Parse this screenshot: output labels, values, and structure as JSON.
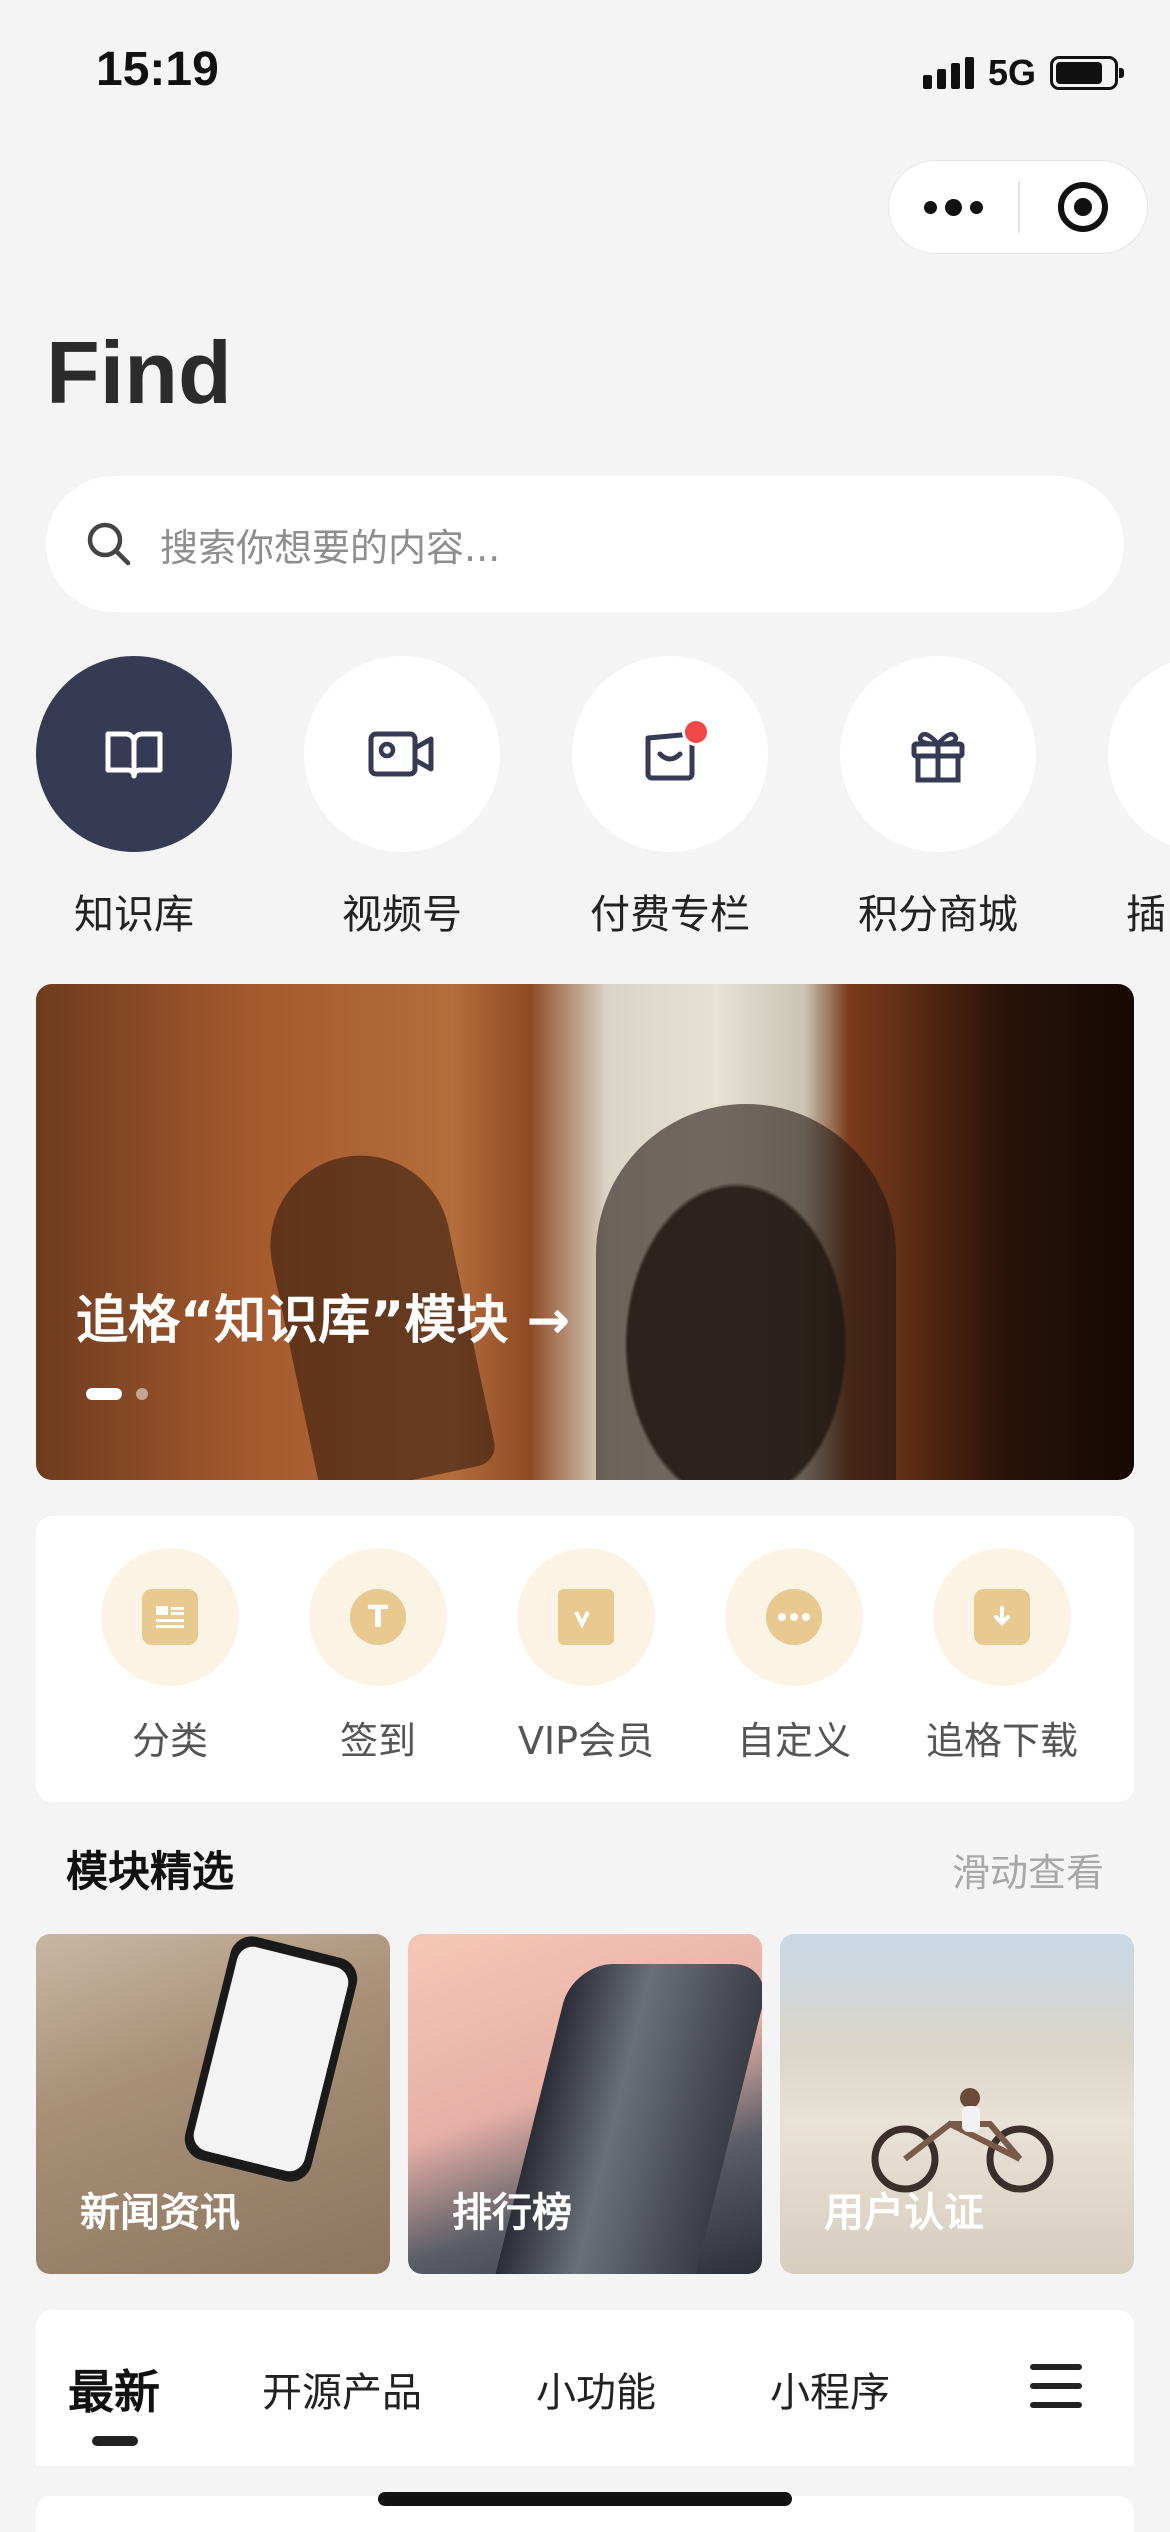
{
  "status": {
    "time": "15:19",
    "network": "5G"
  },
  "page": {
    "title": "Find"
  },
  "search": {
    "placeholder": "搜索你想要的内容..."
  },
  "nav_items": [
    {
      "label": "知识库",
      "icon": "book-icon"
    },
    {
      "label": "视频号",
      "icon": "video-camera-icon"
    },
    {
      "label": "付费专栏",
      "icon": "shopping-bag-icon",
      "badge": true
    },
    {
      "label": "积分商城",
      "icon": "gift-icon"
    },
    {
      "label": "插",
      "icon": "partial-icon"
    }
  ],
  "banner": {
    "title": "追格“知识库”模块 →",
    "slides": 2,
    "current": 1
  },
  "quick_items": [
    {
      "label": "分类",
      "icon": "list-doc-icon"
    },
    {
      "label": "签到",
      "icon": "t-coin-icon"
    },
    {
      "label": "VIP会员",
      "icon": "vip-wallet-icon"
    },
    {
      "label": "自定义",
      "icon": "more-dots-icon"
    },
    {
      "label": "追格下载",
      "icon": "download-folder-icon"
    }
  ],
  "section": {
    "title": "模块精选",
    "hint": "滑动查看"
  },
  "cards": [
    {
      "label": "新闻资讯"
    },
    {
      "label": "排行榜"
    },
    {
      "label": "用户认证"
    }
  ],
  "tabs": [
    {
      "label": "最新",
      "active": true
    },
    {
      "label": "开源产品"
    },
    {
      "label": "小功能"
    },
    {
      "label": "小程序"
    }
  ],
  "colors": {
    "accent_dark": "#363a55",
    "badge_red": "#f04747",
    "quick_icon": "#e8c98f"
  }
}
